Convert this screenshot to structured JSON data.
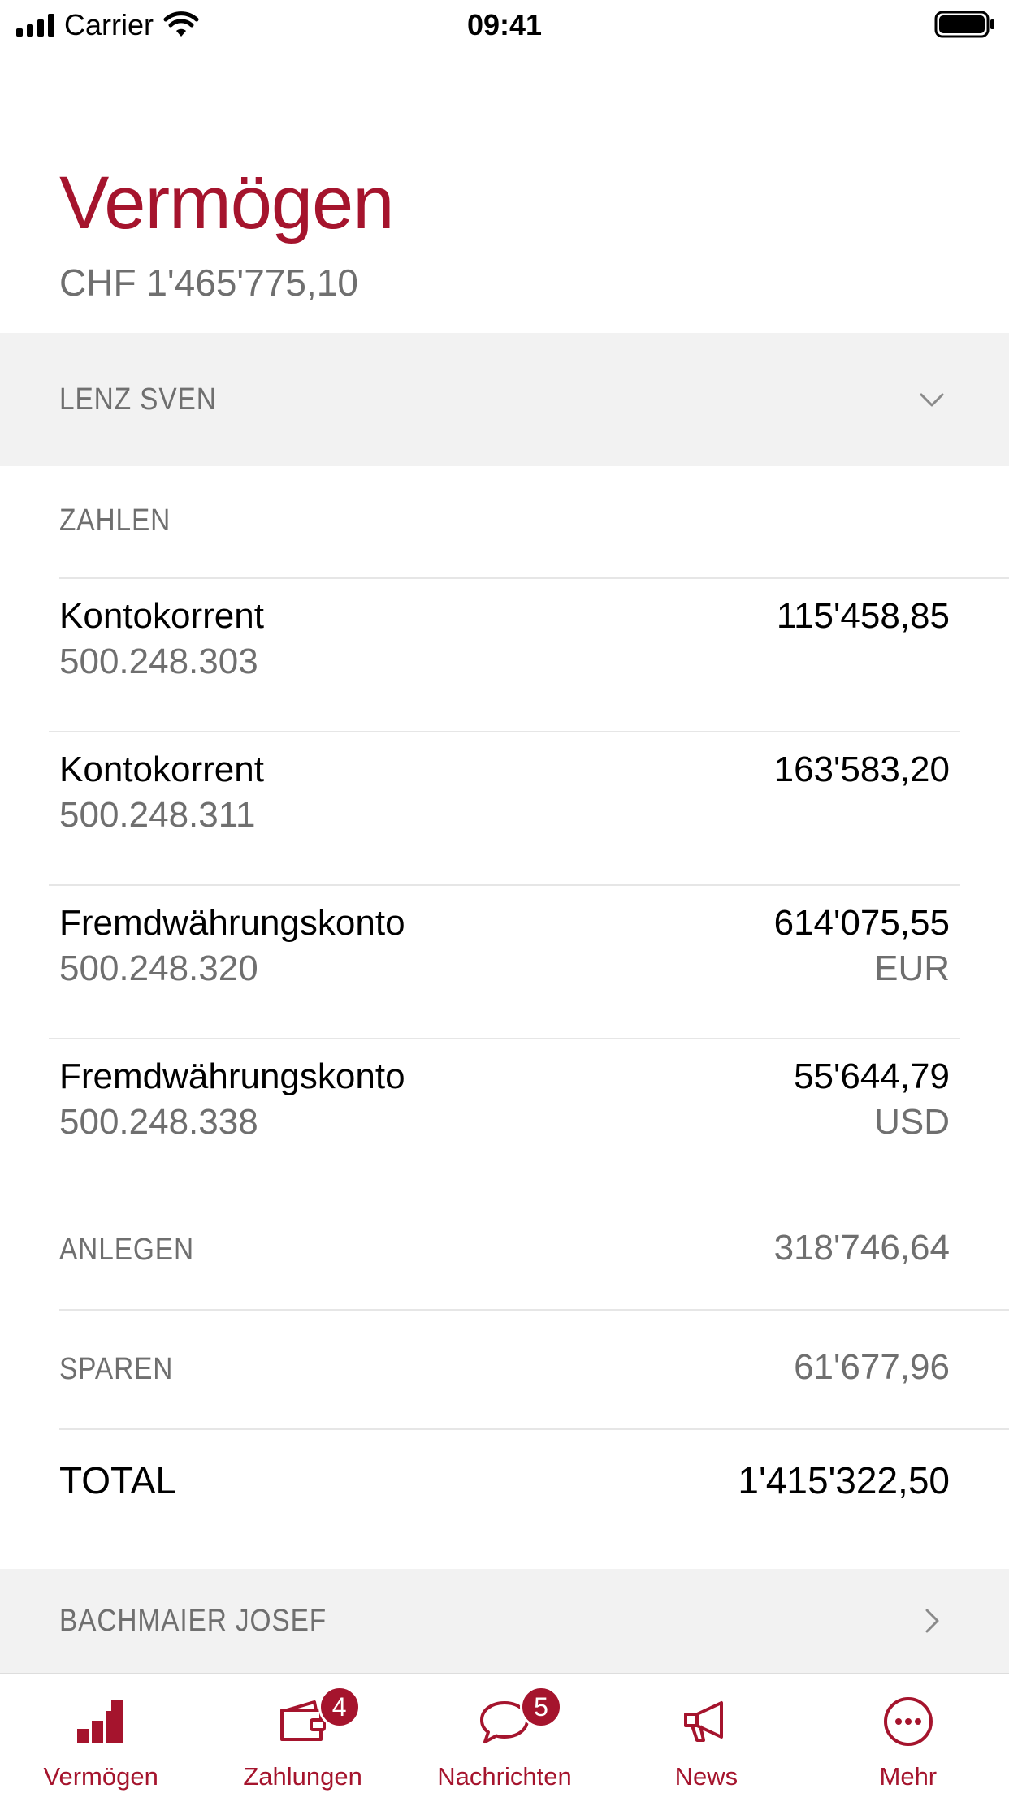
{
  "status_bar": {
    "carrier": "Carrier",
    "time": "09:41"
  },
  "header": {
    "title": "Vermögen",
    "total": "CHF 1'465'775,10"
  },
  "groups": [
    {
      "name": "LENZ SVEN",
      "expanded": true,
      "sections": {
        "zahlen": {
          "label": "ZAHLEN",
          "accounts": [
            {
              "name": "Kontokorrent",
              "number": "500.248.303",
              "amount": "115'458,85",
              "currency": ""
            },
            {
              "name": "Kontokorrent",
              "number": "500.248.311",
              "amount": "163'583,20",
              "currency": ""
            },
            {
              "name": "Fremdwährungskonto",
              "number": "500.248.320",
              "amount": "614'075,55",
              "currency": "EUR"
            },
            {
              "name": "Fremdwährungskonto",
              "number": "500.248.338",
              "amount": "55'644,79",
              "currency": "USD"
            }
          ]
        },
        "anlegen": {
          "label": "ANLEGEN",
          "value": "318'746,64"
        },
        "sparen": {
          "label": "SPAREN",
          "value": "61'677,96"
        },
        "total": {
          "label": "TOTAL",
          "value": "1'415'322,50"
        }
      }
    },
    {
      "name": "BACHMAIER JOSEF",
      "expanded": false
    }
  ],
  "tab_bar": {
    "active": "Vermögen",
    "accent_color": "#a5142d",
    "tabs": [
      {
        "label": "Vermögen",
        "icon": "bar-chart-icon",
        "badge": ""
      },
      {
        "label": "Zahlungen",
        "icon": "wallet-icon",
        "badge": "4"
      },
      {
        "label": "Nachrichten",
        "icon": "chat-bubble-icon",
        "badge": "5"
      },
      {
        "label": "News",
        "icon": "megaphone-icon",
        "badge": ""
      },
      {
        "label": "Mehr",
        "icon": "more-icon",
        "badge": ""
      }
    ]
  }
}
